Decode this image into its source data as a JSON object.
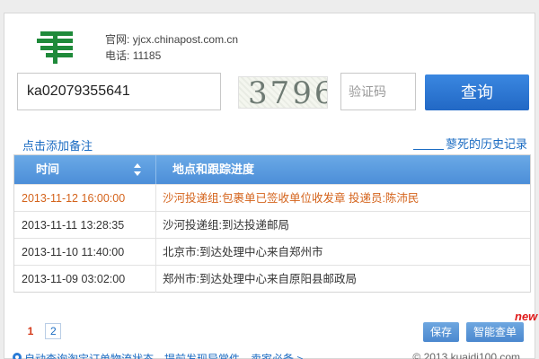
{
  "site": {
    "official_label": "官网:",
    "official_value": "yjcx.chinapost.com.cn",
    "phone_label": "电话:",
    "phone_value": "11185"
  },
  "search": {
    "tracking_number": "ka02079355641",
    "captcha_code": "3796",
    "captcha_placeholder": "验证码",
    "query_label": "查询"
  },
  "links": {
    "add_note": "点击添加备注",
    "history": "蓼死的历史记录"
  },
  "table": {
    "headers": {
      "time": "时间",
      "progress": "地点和跟踪进度"
    },
    "rows": [
      {
        "time": "2013-11-12 16:00:00",
        "context": "沙河投递组:包裹单已签收单位收发章 投递员:陈沛民"
      },
      {
        "time": "2013-11-11 13:28:35",
        "context": "沙河投递组:到达投递邮局"
      },
      {
        "time": "2013-11-10 11:40:00",
        "context": "北京市:到达处理中心来自郑州市"
      },
      {
        "time": "2013-11-09 03:02:00",
        "context": "郑州市:到达处理中心来自原阳县邮政局"
      }
    ]
  },
  "pagination": {
    "pages": [
      "1",
      "2"
    ],
    "current": "1"
  },
  "actions": {
    "save_label": "保存",
    "smart_label": "智能查单",
    "new_badge": "new"
  },
  "footer": {
    "auto_link": "自动查询淘宝订单物流状态，提前发现异常件，卖家必备 >",
    "copyright": "© 2013 kuaidi100.com"
  },
  "colors": {
    "accent": "#2268c5",
    "header_bg": "#5a9be0",
    "latest_row": "#d4631b",
    "logo_green": "#1f8a3a"
  },
  "icons": {
    "logo": "china-post-logo",
    "sort": "sort-arrows-icon",
    "footer": "gear-icon"
  }
}
